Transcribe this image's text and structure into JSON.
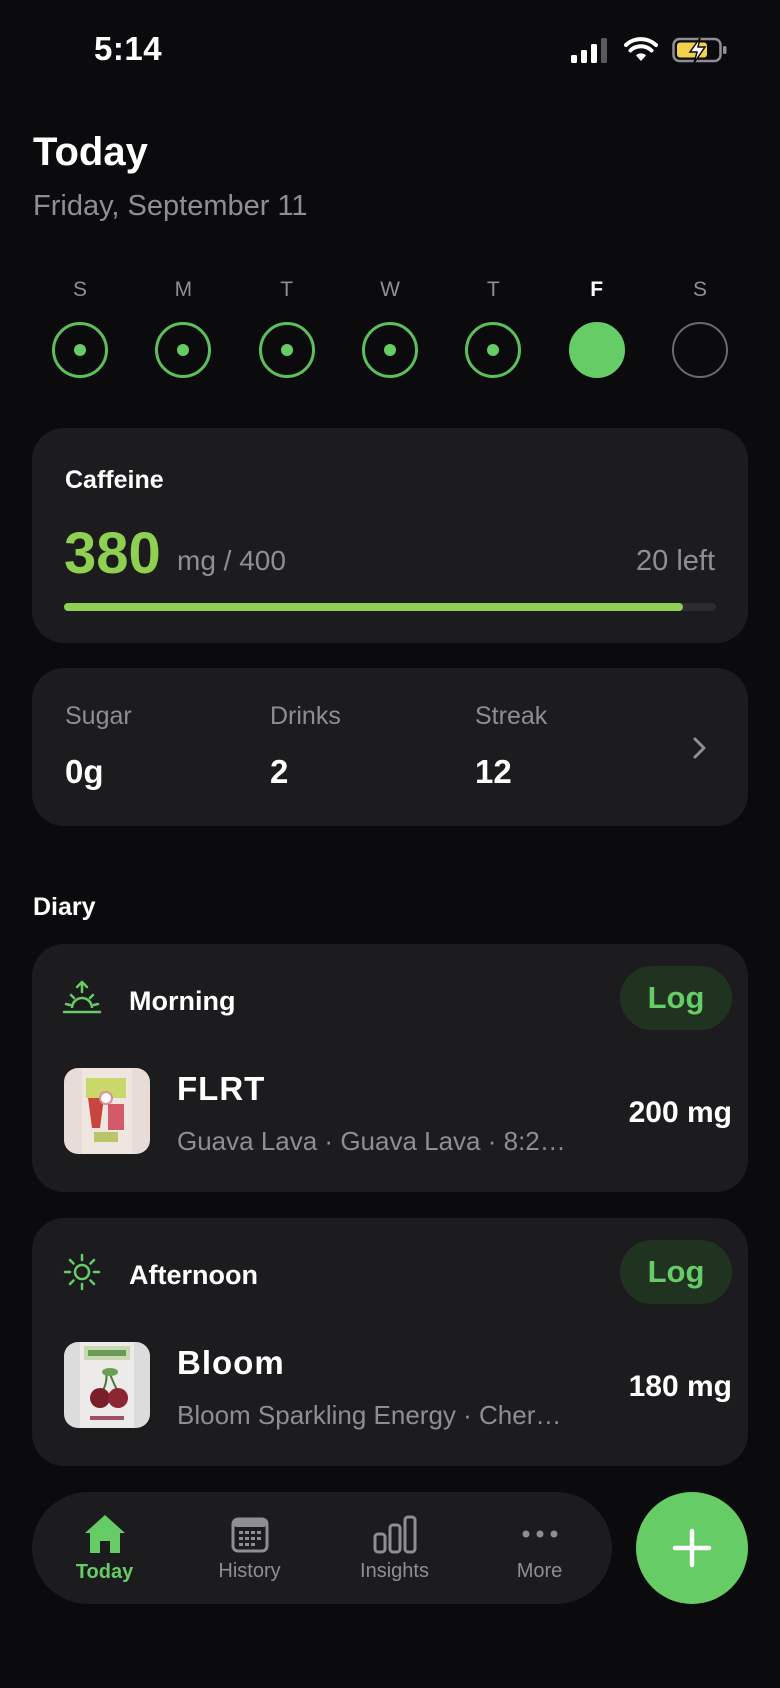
{
  "status": {
    "time": "5:14"
  },
  "header": {
    "title": "Today",
    "subtitle": "Friday, September 11"
  },
  "week": [
    {
      "letter": "S",
      "state": "logged"
    },
    {
      "letter": "M",
      "state": "logged"
    },
    {
      "letter": "T",
      "state": "logged"
    },
    {
      "letter": "W",
      "state": "logged"
    },
    {
      "letter": "T",
      "state": "logged"
    },
    {
      "letter": "F",
      "state": "today"
    },
    {
      "letter": "S",
      "state": "empty"
    }
  ],
  "caffeine": {
    "label": "Caffeine",
    "value": "380",
    "unit": "mg / 400",
    "left": "20 left",
    "progress_fraction": 0.95
  },
  "stats": [
    {
      "label": "Sugar",
      "value": "0g"
    },
    {
      "label": "Drinks",
      "value": "2"
    },
    {
      "label": "Streak",
      "value": "12"
    }
  ],
  "diary": {
    "heading": "Diary",
    "log_label": "Log",
    "meals": [
      {
        "title": "Morning",
        "icon": "sunrise-icon",
        "item": {
          "name": "FLRT",
          "subtitle": "Guava Lava · Guava Lava · 8:2…",
          "amount": "200 mg",
          "thumb": "flrt-can-image"
        }
      },
      {
        "title": "Afternoon",
        "icon": "sun-icon",
        "item": {
          "name": "Bloom",
          "subtitle": "Bloom Sparkling Energy · Cher…",
          "amount": "180 mg",
          "thumb": "bloom-can-image"
        }
      }
    ]
  },
  "tabs": [
    {
      "label": "Today",
      "icon": "home-icon",
      "active": true
    },
    {
      "label": "History",
      "icon": "calendar-icon",
      "active": false
    },
    {
      "label": "Insights",
      "icon": "bar-chart-icon",
      "active": false
    },
    {
      "label": "More",
      "icon": "ellipsis-icon",
      "active": false
    }
  ],
  "colors": {
    "accent": "#66cc66",
    "caffeine": "#8fcf52",
    "card": "#1c1c1e",
    "background": "#0b0b0d"
  }
}
